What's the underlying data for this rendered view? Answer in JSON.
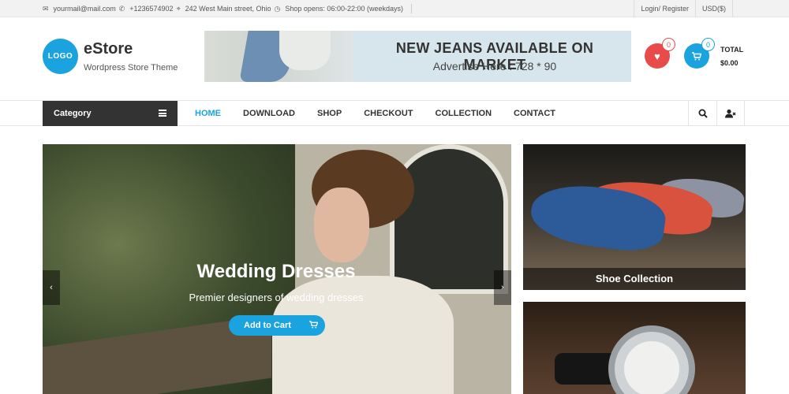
{
  "topbar": {
    "email": "yourmail@mail.com",
    "phone": "+1236574902",
    "address": "242 West Main street, Ohio",
    "hours": "Shop opens: 06:00-22:00 (weekdays)",
    "login": "Login/ Register",
    "currency": "USD($)"
  },
  "header": {
    "logo_text": "LOGO",
    "site_title": "eStore",
    "site_desc": "Wordpress Store Theme",
    "wishlist_count": "0",
    "cart_count": "0",
    "total_label": "TOTAL",
    "total_value": "$0.00"
  },
  "banner": {
    "title": "NEW JEANS AVAILABLE ON MARKET",
    "subtitle": "Advertise Here : 728 * 90"
  },
  "nav": {
    "category_label": "Category",
    "items": [
      "HOME",
      "DOWNLOAD",
      "SHOP",
      "CHECKOUT",
      "COLLECTION",
      "CONTACT"
    ],
    "active": "HOME"
  },
  "slider": {
    "title": "Wedding Dresses",
    "subtitle": "Premier designers of wedding dresses",
    "button_label": "Add to Cart"
  },
  "side_banners": {
    "shoe_caption": "Shoe Collection"
  },
  "colors": {
    "accent": "#1aa3df",
    "wishlist": "#e94a4a",
    "dark": "#333333"
  }
}
